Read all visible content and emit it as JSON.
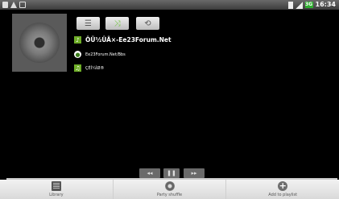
{
  "status_bar": {
    "time": "16:34",
    "network_label": "3G"
  },
  "controls": {
    "list_icon": "list-icon",
    "shuffle_icon": "shuffle-icon",
    "repeat_icon": "repeat-icon"
  },
  "track": {
    "artist": "ÔÜ½ÛÃ×-Ee23Forum.Net",
    "album": "Ee23Forum.Net/Bbs",
    "title": "ÇÉÍ¼ÌØ®"
  },
  "playback": {
    "prev_label": "◂◂",
    "pause_label": "❚❚",
    "next_label": "▸▸"
  },
  "nav": {
    "library": "Library",
    "party_shuffle": "Party shuffle",
    "add_to_playlist": "Add to playlist"
  },
  "colors": {
    "accent_green": "#6fae28",
    "background": "#000000"
  }
}
